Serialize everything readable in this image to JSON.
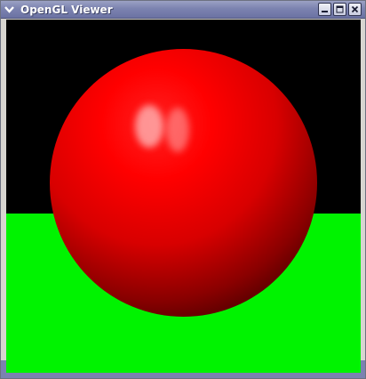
{
  "window": {
    "title": "OpenGL Viewer"
  },
  "titlebar_icons": {
    "menu": "chevron-down-icon",
    "minimize": "minimize-icon",
    "maximize": "maximize-icon",
    "close": "close-icon"
  },
  "scene": {
    "background_color": "#000000",
    "ground_color": "#00f300",
    "sphere_color": "#ff0000"
  }
}
